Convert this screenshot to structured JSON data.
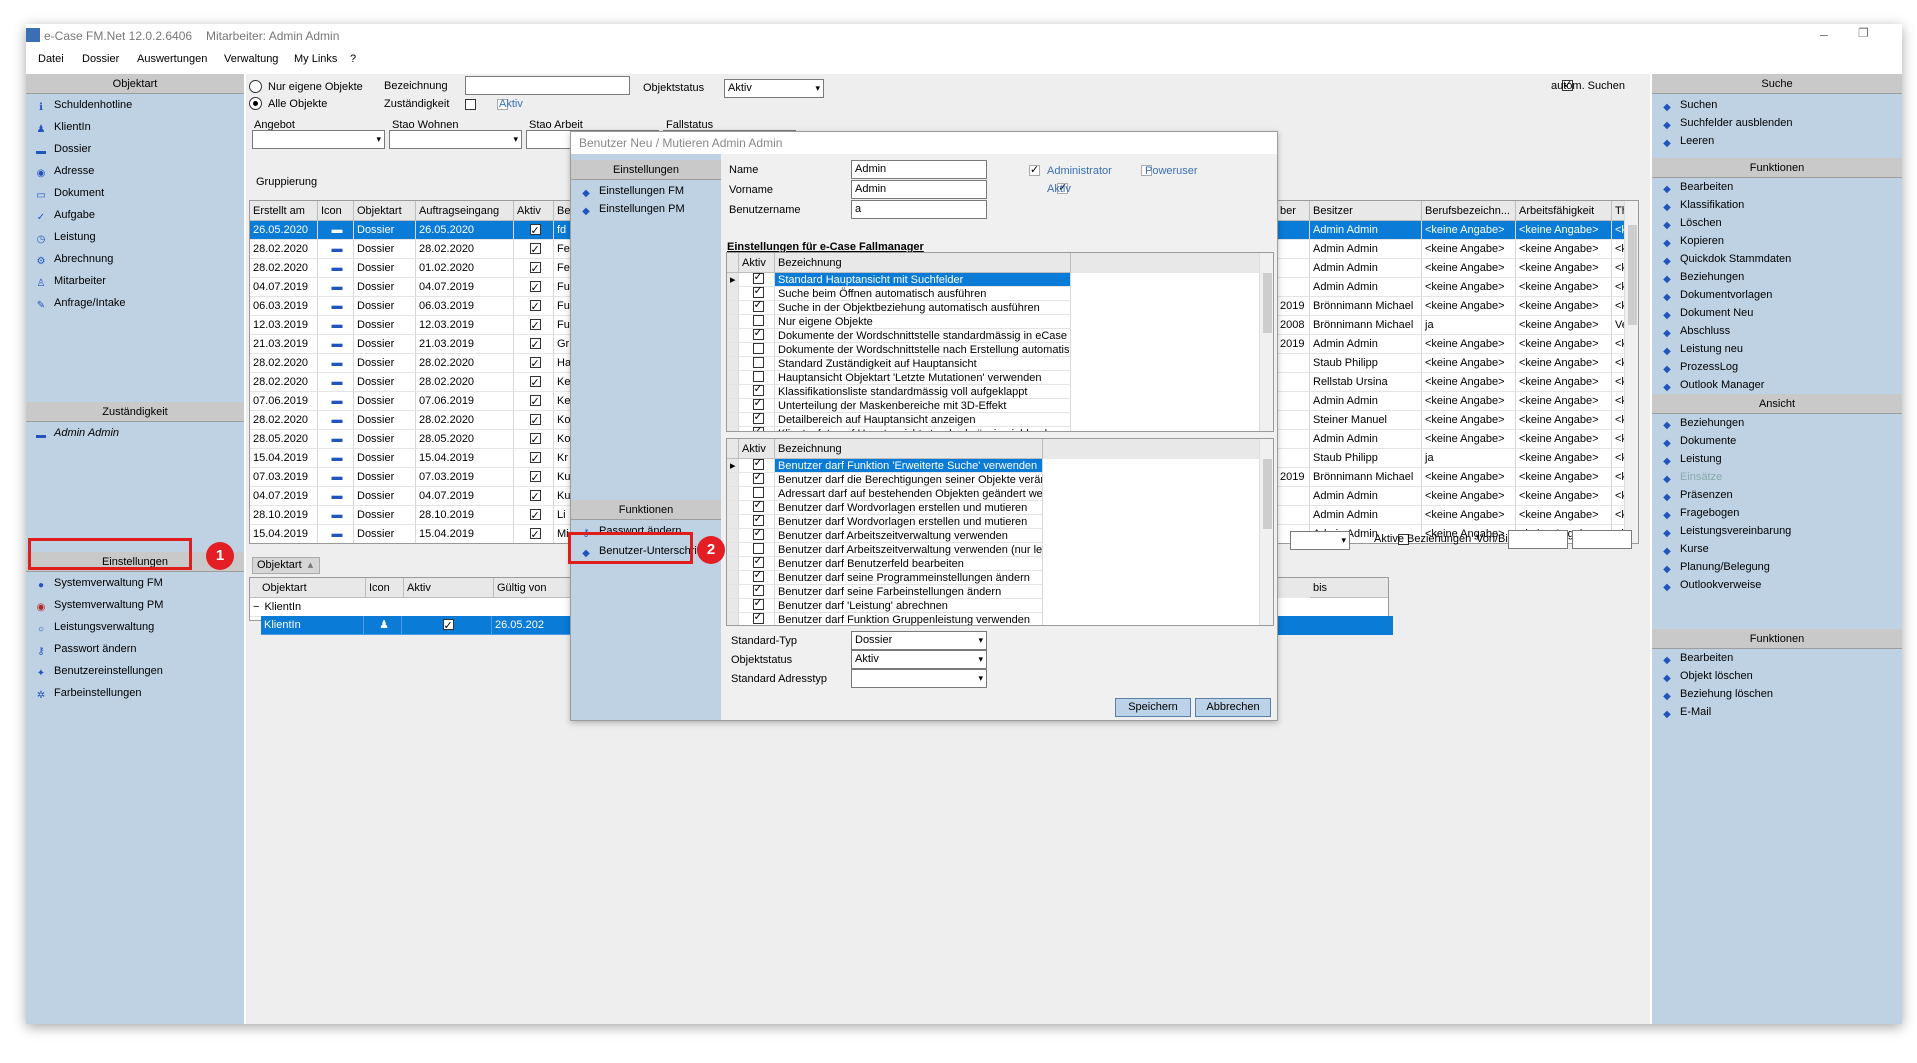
{
  "app": {
    "title": "e-Case FM.Net 12.0.2.6406",
    "user": "Mitarbeiter: Admin Admin",
    "menu": [
      "Datei",
      "Dossier",
      "Auswertungen",
      "Verwaltung",
      "My Links",
      "?"
    ]
  },
  "left": {
    "objektart_header": "Objektart",
    "objektart_items": [
      "Schuldenhotline",
      "KlientIn",
      "Dossier",
      "Adresse",
      "Dokument",
      "Aufgabe",
      "Leistung",
      "Abrechnung",
      "Mitarbeiter",
      "Anfrage/Intake"
    ],
    "zust_header": "Zuständigkeit",
    "zust_item": "Admin Admin",
    "einst_header": "Einstellungen",
    "einst_items": [
      "Systemverwaltung FM",
      "Systemverwaltung PM",
      "Leistungsverwaltung",
      "Passwort ändern",
      "Benutzereinstellungen",
      "Farbeinstellungen"
    ]
  },
  "filter": {
    "radio_own": "Nur eigene Objekte",
    "radio_all": "Alle Objekte",
    "bezeichnung_label": "Bezeichnung",
    "zust_label": "Zuständigkeit",
    "aktiv_label": "Aktiv",
    "objektstatus_label": "Objektstatus",
    "objektstatus_value": "Aktiv",
    "autosearch_label": "autom. Suchen",
    "angebot_label": "Angebot",
    "stao_wohnen_label": "Stao Wohnen",
    "stao_arbeit_label": "Stao Arbeit",
    "fallstatus_label": "Fallstatus",
    "gruppierung_label": "Gruppierung"
  },
  "maingrid": {
    "headers": [
      "Erstellt am",
      "Icon",
      "Objektart",
      "Auftragseingang",
      "Aktiv",
      "Be"
    ],
    "rows": [
      {
        "date": "26.05.2020",
        "art": "Dossier",
        "eingang": "26.05.2020",
        "b": "fd"
      },
      {
        "date": "28.02.2020",
        "art": "Dossier",
        "eingang": "28.02.2020",
        "b": "Fe"
      },
      {
        "date": "28.02.2020",
        "art": "Dossier",
        "eingang": "01.02.2020",
        "b": "Fe"
      },
      {
        "date": "04.07.2019",
        "art": "Dossier",
        "eingang": "04.07.2019",
        "b": "Fu"
      },
      {
        "date": "06.03.2019",
        "art": "Dossier",
        "eingang": "06.03.2019",
        "b": "Fu"
      },
      {
        "date": "12.03.2019",
        "art": "Dossier",
        "eingang": "12.03.2019",
        "b": "Fu"
      },
      {
        "date": "21.03.2019",
        "art": "Dossier",
        "eingang": "21.03.2019",
        "b": "Gr"
      },
      {
        "date": "28.02.2020",
        "art": "Dossier",
        "eingang": "28.02.2020",
        "b": "Ha"
      },
      {
        "date": "28.02.2020",
        "art": "Dossier",
        "eingang": "28.02.2020",
        "b": "Ke"
      },
      {
        "date": "07.06.2019",
        "art": "Dossier",
        "eingang": "07.06.2019",
        "b": "Ke"
      },
      {
        "date": "28.02.2020",
        "art": "Dossier",
        "eingang": "28.02.2020",
        "b": "Ko"
      },
      {
        "date": "28.05.2020",
        "art": "Dossier",
        "eingang": "28.05.2020",
        "b": "Ko"
      },
      {
        "date": "15.04.2019",
        "art": "Dossier",
        "eingang": "15.04.2019",
        "b": "Kr"
      },
      {
        "date": "07.03.2019",
        "art": "Dossier",
        "eingang": "07.03.2019",
        "b": "Ku"
      },
      {
        "date": "04.07.2019",
        "art": "Dossier",
        "eingang": "04.07.2019",
        "b": "Ku"
      },
      {
        "date": "28.10.2019",
        "art": "Dossier",
        "eingang": "28.10.2019",
        "b": "Li"
      },
      {
        "date": "15.04.2019",
        "art": "Dossier",
        "eingang": "15.04.2019",
        "b": "Mi"
      }
    ],
    "right_headers": [
      "ber",
      "Besitzer",
      "Berufsbezeichn...",
      "Arbeitsfähigkeit",
      "Th"
    ],
    "right_rows": [
      [
        "",
        "Admin Admin",
        "<keine Angabe>",
        "<keine Angabe>",
        "<k"
      ],
      [
        "",
        "Admin Admin",
        "<keine Angabe>",
        "<keine Angabe>",
        "<k"
      ],
      [
        "",
        "Admin Admin",
        "<keine Angabe>",
        "<keine Angabe>",
        "<k"
      ],
      [
        "",
        "Admin Admin",
        "<keine Angabe>",
        "<keine Angabe>",
        "<k"
      ],
      [
        "2019",
        "Brönnimann Michael",
        "<keine Angabe>",
        "<keine Angabe>",
        "<k"
      ],
      [
        "2008",
        "Brönnimann Michael",
        "ja",
        "<keine Angabe>",
        "Ve"
      ],
      [
        "2019",
        "Admin Admin",
        "<keine Angabe>",
        "<keine Angabe>",
        "<k"
      ],
      [
        "",
        "Staub Philipp",
        "<keine Angabe>",
        "<keine Angabe>",
        "<k"
      ],
      [
        "",
        "Rellstab Ursina",
        "<keine Angabe>",
        "<keine Angabe>",
        "<k"
      ],
      [
        "",
        "Admin Admin",
        "<keine Angabe>",
        "<keine Angabe>",
        "<k"
      ],
      [
        "",
        "Steiner Manuel",
        "<keine Angabe>",
        "<keine Angabe>",
        "<k"
      ],
      [
        "",
        "Admin Admin",
        "<keine Angabe>",
        "<keine Angabe>",
        "<k"
      ],
      [
        "",
        "Staub Philipp",
        "ja",
        "<keine Angabe>",
        "<k"
      ],
      [
        "2019",
        "Brönnimann Michael",
        "<keine Angabe>",
        "<keine Angabe>",
        "<k"
      ],
      [
        "",
        "Admin Admin",
        "<keine Angabe>",
        "<keine Angabe>",
        "<k"
      ],
      [
        "",
        "Admin Admin",
        "<keine Angabe>",
        "<keine Angabe>",
        "<k"
      ],
      [
        "",
        "Admin Admin",
        "<keine Angabe>",
        "<keine Angabe>",
        "<k"
      ]
    ]
  },
  "lower": {
    "group_chip": "Objektart",
    "headers": [
      "Objektart",
      "Icon",
      "Aktiv",
      "Gültig von"
    ],
    "group_row": "KlientIn",
    "row": {
      "art": "KlientIn",
      "date": "26.05.202"
    },
    "bis_header": "bis",
    "aktive_bez_label": "Aktive Beziehungen",
    "vonbis_label": "Von/Bis"
  },
  "dialog": {
    "title": "Benutzer Neu / Mutieren Admin Admin",
    "einst_header": "Einstellungen",
    "einst_items": [
      "Einstellungen FM",
      "Einstellungen PM"
    ],
    "funk_header": "Funktionen",
    "funk_items": [
      "Passwort ändern",
      "Benutzer-Unterschrift"
    ],
    "name_label": "Name",
    "name_value": "Admin",
    "vorname_label": "Vorname",
    "vorname_value": "Admin",
    "benutzername_label": "Benutzername",
    "benutzername_value": "a",
    "admin_label": "Administrator",
    "power_label": "Poweruser",
    "aktiv_label": "Aktiv",
    "section_title": "Einstellungen für e-Case Fallmanager",
    "col_aktiv": "Aktiv",
    "col_bez": "Bezeichnung",
    "settings": [
      {
        "t": "Standard Hauptansicht mit Suchfelder",
        "on": true
      },
      {
        "t": "Suche beim Öffnen automatisch ausführen",
        "on": true
      },
      {
        "t": "Suche in der Objektbeziehung automatisch ausführen",
        "on": true
      },
      {
        "t": "Nur eigene Objekte",
        "on": false
      },
      {
        "t": "Dokumente der Wordschnittstelle standardmässig in eCase speichern",
        "on": true
      },
      {
        "t": "Dokumente der Wordschnittstelle nach Erstellung automatisch speichern",
        "on": false
      },
      {
        "t": "Standard Zuständigkeit auf Hauptansicht",
        "on": false
      },
      {
        "t": "Hauptansicht Objektart 'Letzte Mutationen' verwenden",
        "on": false
      },
      {
        "t": "Klassifikationsliste standardmässig voll aufgeklappt",
        "on": true
      },
      {
        "t": "Unterteilung der Maskenbereiche mit 3D-Effekt",
        "on": true
      },
      {
        "t": "Detailbereich auf Hauptansicht anzeigen",
        "on": true
      },
      {
        "t": "Klientenfoto auf Hauptansicht standardmässig einblenden",
        "on": true
      }
    ],
    "rights": [
      {
        "t": "Benutzer darf Funktion 'Erweiterte Suche' verwenden",
        "on": true
      },
      {
        "t": "Benutzer darf die Berechtigungen seiner Objekte verändern",
        "on": true
      },
      {
        "t": "Adressart darf auf bestehenden Objekten geändert werden",
        "on": false
      },
      {
        "t": "Benutzer darf Wordvorlagen erstellen und mutieren",
        "on": true
      },
      {
        "t": "Benutzer darf Wordvorlagen erstellen und mutieren",
        "on": true
      },
      {
        "t": "Benutzer darf Arbeitszeitverwaltung verwenden",
        "on": true
      },
      {
        "t": "Benutzer darf Arbeitszeitverwaltung verwenden (nur lesen)",
        "on": false
      },
      {
        "t": "Benutzer darf Benutzerfeld bearbeiten",
        "on": true
      },
      {
        "t": "Benutzer darf seine Programmeinstellungen ändern",
        "on": true
      },
      {
        "t": "Benutzer darf seine Farbeinstellungen ändern",
        "on": true
      },
      {
        "t": "Benutzer darf 'Leistung' abrechnen",
        "on": true
      },
      {
        "t": "Benutzer darf Funktion Gruppenleistung verwenden",
        "on": true
      }
    ],
    "standard_typ_label": "Standard-Typ",
    "standard_typ_value": "Dossier",
    "objektstatus_label": "Objektstatus",
    "objektstatus_value": "Aktiv",
    "adresstyp_label": "Standard Adresstyp",
    "adresstyp_value": "",
    "save": "Speichern",
    "cancel": "Abbrechen"
  },
  "right": {
    "suche_header": "Suche",
    "suche_items": [
      "Suchen",
      "Suchfelder ausblenden",
      "Leeren"
    ],
    "funk_header": "Funktionen",
    "funk_items": [
      "Bearbeiten",
      "Klassifikation",
      "Löschen",
      "Kopieren",
      "Quickdok Stammdaten",
      "Beziehungen",
      "Dokumentvorlagen",
      "Dokument Neu",
      "Abschluss",
      "Leistung neu",
      "ProzessLog",
      "Outlook Manager"
    ],
    "ansicht_header": "Ansicht",
    "ansicht_items": [
      "Beziehungen",
      "Dokumente",
      "Leistung",
      "Einsätze",
      "Präsenzen",
      "Fragebogen",
      "Leistungsvereinbarung",
      "Kurse",
      "Planung/Belegung",
      "Outlookverweise"
    ],
    "funk2_header": "Funktionen",
    "funk2_items": [
      "Bearbeiten",
      "Objekt löschen",
      "Beziehung löschen",
      "E-Mail"
    ]
  },
  "annotations": {
    "one": "1",
    "two": "2"
  },
  "colors": {
    "selection": "#0a7bd6",
    "panel": "#bfd2e4",
    "marker": "#e01d1d"
  }
}
